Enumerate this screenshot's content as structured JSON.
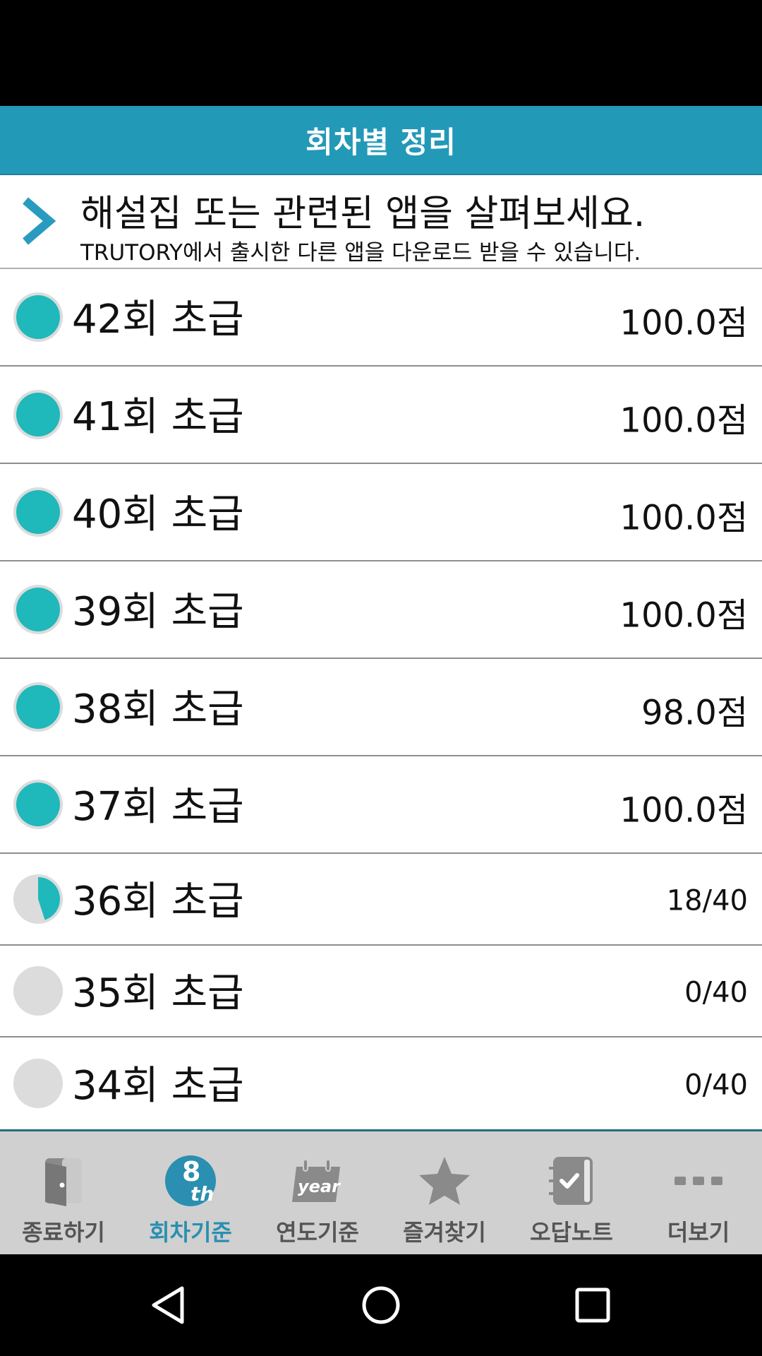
{
  "header": {
    "title": "회차별 정리"
  },
  "promo": {
    "headline": "해설집 또는 관련된 앱을 살펴보세요.",
    "sub": "TRUTORY에서 출시한 다른 앱을 다운로드 받을 수 있습니다."
  },
  "rounds": [
    {
      "name": "42회 초급",
      "score": "100.0점",
      "progress": 1.0
    },
    {
      "name": "41회 초급",
      "score": "100.0점",
      "progress": 1.0
    },
    {
      "name": "40회 초급",
      "score": "100.0점",
      "progress": 1.0
    },
    {
      "name": "39회 초급",
      "score": "100.0점",
      "progress": 1.0
    },
    {
      "name": "38회 초급",
      "score": "98.0점",
      "progress": 1.0
    },
    {
      "name": "37회 초급",
      "score": "100.0점",
      "progress": 1.0
    },
    {
      "name": "36회 초급",
      "score": "18/40",
      "progress": 0.45
    },
    {
      "name": "35회 초급",
      "score": "0/40",
      "progress": 0.0
    },
    {
      "name": "34회 초급",
      "score": "0/40",
      "progress": 0.0
    }
  ],
  "tabs": {
    "exit": "종료하기",
    "round": "회차기준",
    "year": "연도기준",
    "favorites": "즐겨찾기",
    "wrong_notes": "오답노트",
    "more": "더보기"
  },
  "icon_text": {
    "round_badge": "8",
    "round_sup": "th",
    "year_badge": "year"
  },
  "colors": {
    "accent": "#2399b8",
    "progress": "#1fb8bb",
    "track": "#dcdcdc",
    "active_tab": "#2a8fb0"
  }
}
